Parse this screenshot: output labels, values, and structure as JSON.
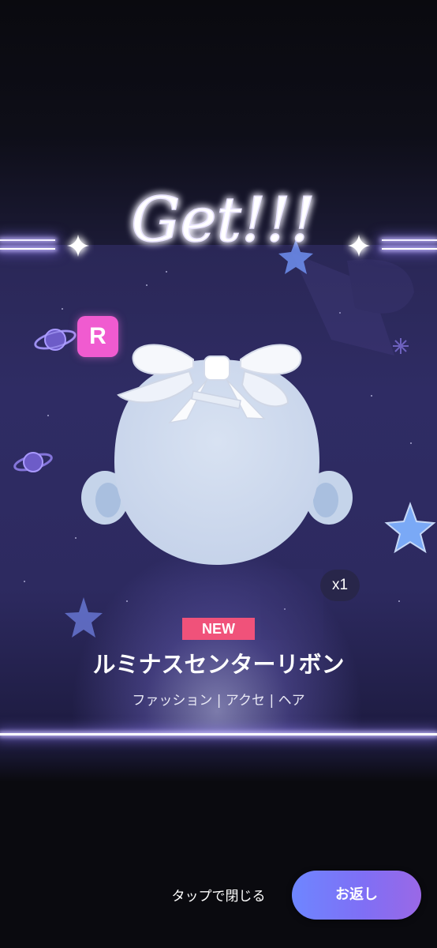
{
  "header": {
    "title": "Get!!!"
  },
  "item": {
    "rarity": "R",
    "quantity": "x1",
    "new_label": "NEW",
    "name": "ルミナスセンターリボン",
    "category": "ファッション | アクセ | ヘア"
  },
  "footer": {
    "close_hint": "タップで閉じる",
    "return_button": "お返し"
  },
  "colors": {
    "background": "#0a0a0f",
    "panel": "#2d2a60",
    "rarity_badge": "#f05bd0",
    "new_badge": "#f0527a",
    "button_start": "#6e86ff",
    "button_end": "#9a68e6",
    "star_glow": "#7fa0ff"
  },
  "icons": {
    "sparkle_left": "sparkle-icon",
    "sparkle_right": "sparkle-icon",
    "planet": "planet-icon",
    "star": "star-icon"
  }
}
